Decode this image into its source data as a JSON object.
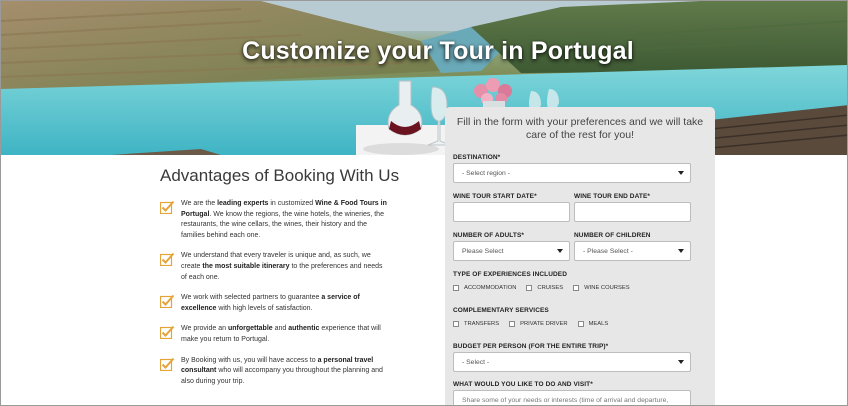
{
  "hero": {
    "title": "Customize your Tour in Portugal"
  },
  "advantages": {
    "title": "Advantages of Booking With Us",
    "items": [
      {
        "pre": "We are the ",
        "bold1": "leading experts",
        "mid": " in customized ",
        "bold2": "Wine & Food Tours in Portugal",
        "post": ". We know the regions, the wine hotels, the wineries, the restaurants, the wine cellars, the wines, their history and the families behind each one."
      },
      {
        "pre": "We understand that every traveler is unique and, as such, we create ",
        "bold1": "the most suitable itinerary",
        "mid": " to the preferences and needs of each one.",
        "bold2": "",
        "post": ""
      },
      {
        "pre": "We work with selected partners to guarantee ",
        "bold1": "a service of excellence",
        "mid": " with high levels of satisfaction.",
        "bold2": "",
        "post": ""
      },
      {
        "pre": "We provide an ",
        "bold1": "unforgettable",
        "mid": " and ",
        "bold2": "authentic",
        "post": " experience that will make you return to Portugal."
      },
      {
        "pre": "By Booking with us, you will have access to ",
        "bold1": "a personal travel consultant",
        "mid": " who will accompany you throughout the planning and also during your trip.",
        "bold2": "",
        "post": ""
      }
    ]
  },
  "form": {
    "intro": "Fill in the form with your preferences and we will take care of the rest for you!",
    "destination_label": "DESTINATION*",
    "destination_value": "- Select region -",
    "start_date_label": "WINE TOUR START DATE*",
    "end_date_label": "WINE TOUR END DATE*",
    "adults_label": "NUMBER OF ADULTS*",
    "adults_value": "Please Select",
    "children_label": "NUMBER OF CHILDREN",
    "children_value": "- Please Select -",
    "experiences_label": "TYPE OF EXPERIENCES INCLUDED",
    "experiences": [
      "ACCOMMODATION",
      "CRUISES",
      "WINE COURSES"
    ],
    "services_label": "COMPLEMENTARY SERVICES",
    "services": [
      "TRANSFERS",
      "PRIVATE DRIVER",
      "MEALS"
    ],
    "budget_label": "BUDGET PER PERSON (FOR THE ENTIRE TRIP)*",
    "budget_value": "- Select -",
    "visit_label": "WHAT WOULD YOU LIKE TO DO AND VISIT*",
    "visit_placeholder": "Share some of your needs or interests (time of arrival and departure,"
  }
}
